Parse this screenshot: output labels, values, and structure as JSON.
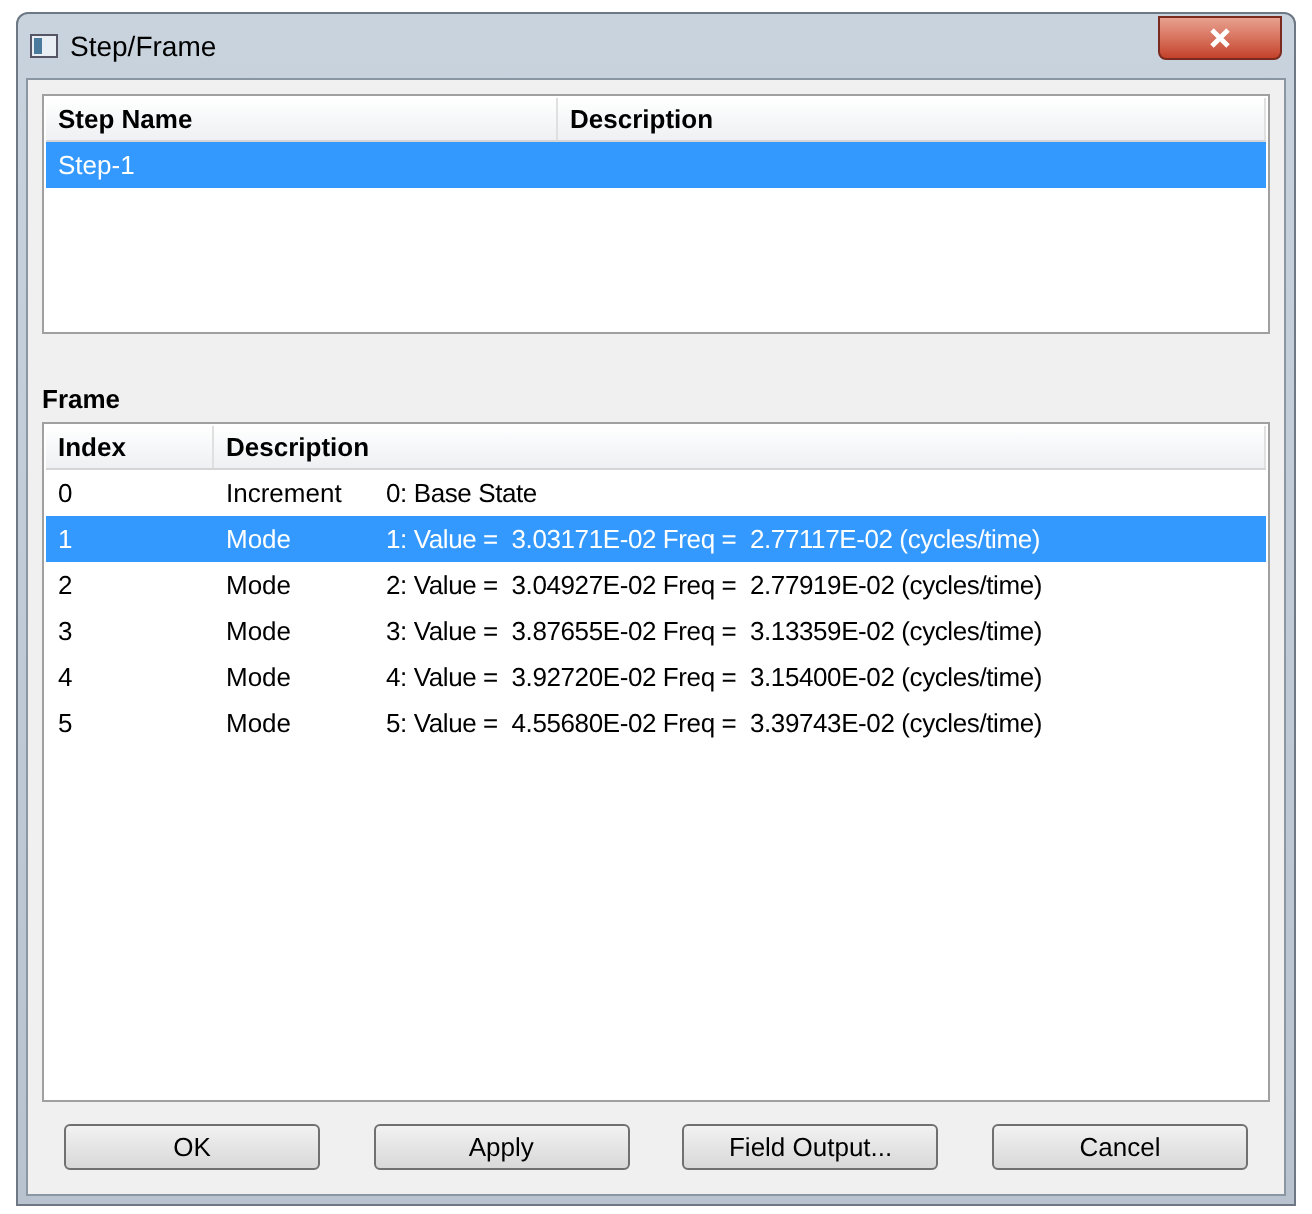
{
  "window": {
    "title": "Step/Frame"
  },
  "steps": {
    "columns": [
      "Step Name",
      "Description"
    ],
    "rows": [
      {
        "name": "Step-1",
        "description": "",
        "selected": true
      }
    ]
  },
  "frame_label": "Frame",
  "frames": {
    "columns": [
      "Index",
      "Description"
    ],
    "rows": [
      {
        "index": "0",
        "type": "Increment",
        "detail": "0: Base State",
        "selected": false
      },
      {
        "index": "1",
        "type": "Mode",
        "detail": "1: Value =  3.03171E-02 Freq =  2.77117E-02 (cycles/time)",
        "selected": true
      },
      {
        "index": "2",
        "type": "Mode",
        "detail": "2: Value =  3.04927E-02 Freq =  2.77919E-02 (cycles/time)",
        "selected": false
      },
      {
        "index": "3",
        "type": "Mode",
        "detail": "3: Value =  3.87655E-02 Freq =  3.13359E-02 (cycles/time)",
        "selected": false
      },
      {
        "index": "4",
        "type": "Mode",
        "detail": "4: Value =  3.92720E-02 Freq =  3.15400E-02 (cycles/time)",
        "selected": false
      },
      {
        "index": "5",
        "type": "Mode",
        "detail": "5: Value =  4.55680E-02 Freq =  3.39743E-02 (cycles/time)",
        "selected": false
      }
    ]
  },
  "buttons": [
    "OK",
    "Apply",
    "Field Output...",
    "Cancel"
  ]
}
